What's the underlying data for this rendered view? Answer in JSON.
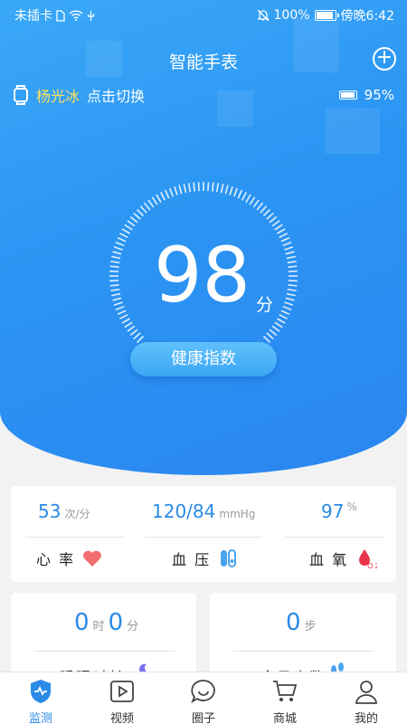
{
  "status_bar": {
    "carrier": "未插卡",
    "battery_pct": "100%",
    "time": "傍晚6:42"
  },
  "header": {
    "title": "智能手表"
  },
  "device": {
    "user_name": "杨光冰",
    "switch_label": "点击切换",
    "battery": "95%"
  },
  "health": {
    "score": "98",
    "score_unit": "分",
    "button_label": "健康指数"
  },
  "vitals": {
    "heart_rate": {
      "value": "53",
      "unit": "次/分",
      "label": "心 率"
    },
    "blood_pressure": {
      "value": "120/84",
      "unit": "mmHg",
      "label": "血 压"
    },
    "blood_oxygen": {
      "value": "97",
      "unit": "%",
      "label": "血 氧"
    }
  },
  "sleep": {
    "hours": "0",
    "hours_unit": "时",
    "minutes": "0",
    "minutes_unit": "分",
    "label": "睡眠时长"
  },
  "steps": {
    "value": "0",
    "unit": "步",
    "label": "今日步数"
  },
  "tabbar": {
    "items": [
      {
        "label": "监测",
        "icon": "monitor-icon",
        "active": true
      },
      {
        "label": "视频",
        "icon": "video-icon"
      },
      {
        "label": "圈子",
        "icon": "chat-icon"
      },
      {
        "label": "商城",
        "icon": "cart-icon"
      },
      {
        "label": "我的",
        "icon": "profile-icon"
      }
    ]
  },
  "colors": {
    "primary": "#2a8ae6",
    "hero": "#3aa8f8",
    "highlight": "#ffe15a",
    "heart": "#f26d6d",
    "oxygen": "#e8344a"
  }
}
